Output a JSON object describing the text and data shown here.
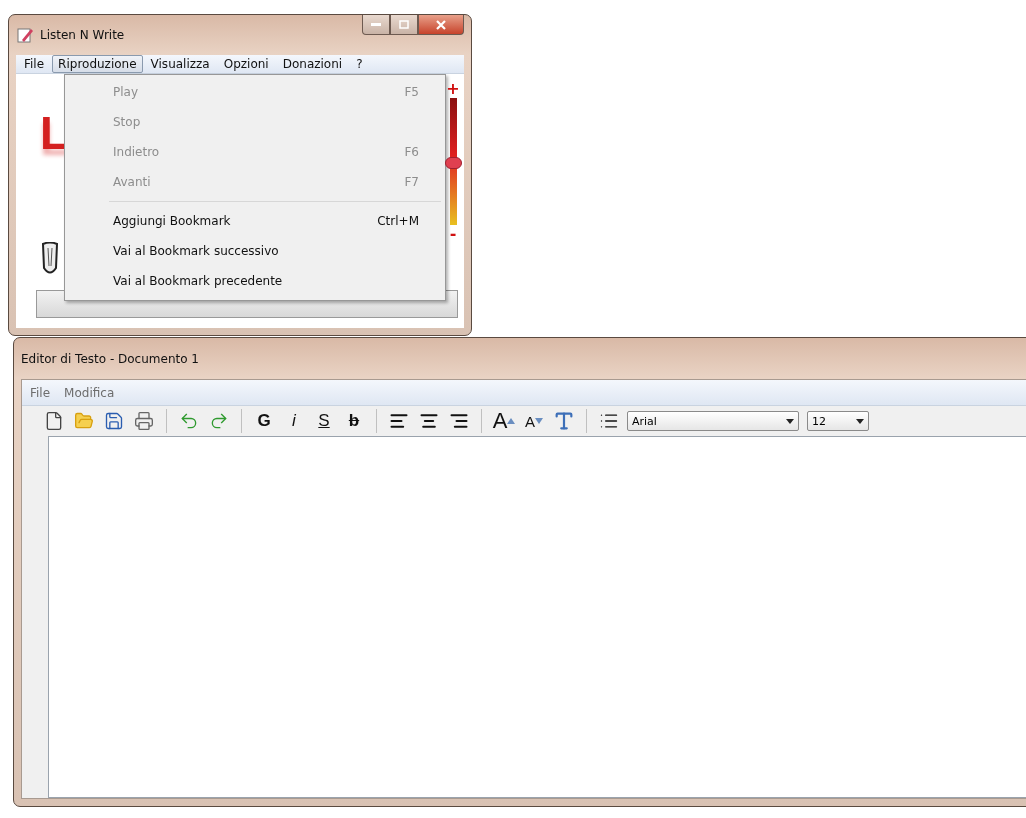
{
  "main_window": {
    "title": "Listen N Write",
    "menu": [
      {
        "label": "File",
        "selected": false
      },
      {
        "label": "Riproduzione",
        "selected": true
      },
      {
        "label": "Visualizza",
        "selected": false
      },
      {
        "label": "Opzioni",
        "selected": false
      },
      {
        "label": "Donazioni",
        "selected": false
      },
      {
        "label": "?",
        "selected": false
      }
    ],
    "logo_text": "L",
    "volume": {
      "plus": "+",
      "minus": "-",
      "level": 0.5
    },
    "dropdown": [
      {
        "kind": "item",
        "label": "Play",
        "shortcut": "F5",
        "disabled": true
      },
      {
        "kind": "item",
        "label": "Stop",
        "disabled": true
      },
      {
        "kind": "item",
        "label": "Indietro",
        "shortcut": "F6",
        "disabled": true
      },
      {
        "kind": "item",
        "label": "Avanti",
        "shortcut": "F7",
        "disabled": true
      },
      {
        "kind": "separator"
      },
      {
        "kind": "item",
        "label": "Aggiungi Bookmark",
        "shortcut": "Ctrl+M",
        "disabled": false
      },
      {
        "kind": "item",
        "label": "Vai al Bookmark successivo",
        "disabled": false
      },
      {
        "kind": "item",
        "label": "Vai al Bookmark precedente",
        "disabled": false
      }
    ]
  },
  "editor_window": {
    "title": "Editor di Testo - Documento 1",
    "menu": [
      {
        "label": "File"
      },
      {
        "label": "Modifica"
      }
    ],
    "toolbar": [
      {
        "kind": "new"
      },
      {
        "kind": "open"
      },
      {
        "kind": "save"
      },
      {
        "kind": "print"
      },
      {
        "kind": "separator"
      },
      {
        "kind": "undo"
      },
      {
        "kind": "redo"
      },
      {
        "kind": "separator"
      },
      {
        "kind": "bold",
        "label": "G"
      },
      {
        "kind": "italic",
        "label": "i"
      },
      {
        "kind": "underline",
        "label": "S"
      },
      {
        "kind": "strike",
        "label": "b"
      },
      {
        "kind": "separator"
      },
      {
        "kind": "align_left"
      },
      {
        "kind": "align_center"
      },
      {
        "kind": "align_right"
      },
      {
        "kind": "separator"
      },
      {
        "kind": "grow",
        "label": "A"
      },
      {
        "kind": "shrink",
        "label": "A"
      },
      {
        "kind": "style"
      },
      {
        "kind": "separator"
      },
      {
        "kind": "list"
      }
    ],
    "font": "Arial",
    "size": "12"
  }
}
